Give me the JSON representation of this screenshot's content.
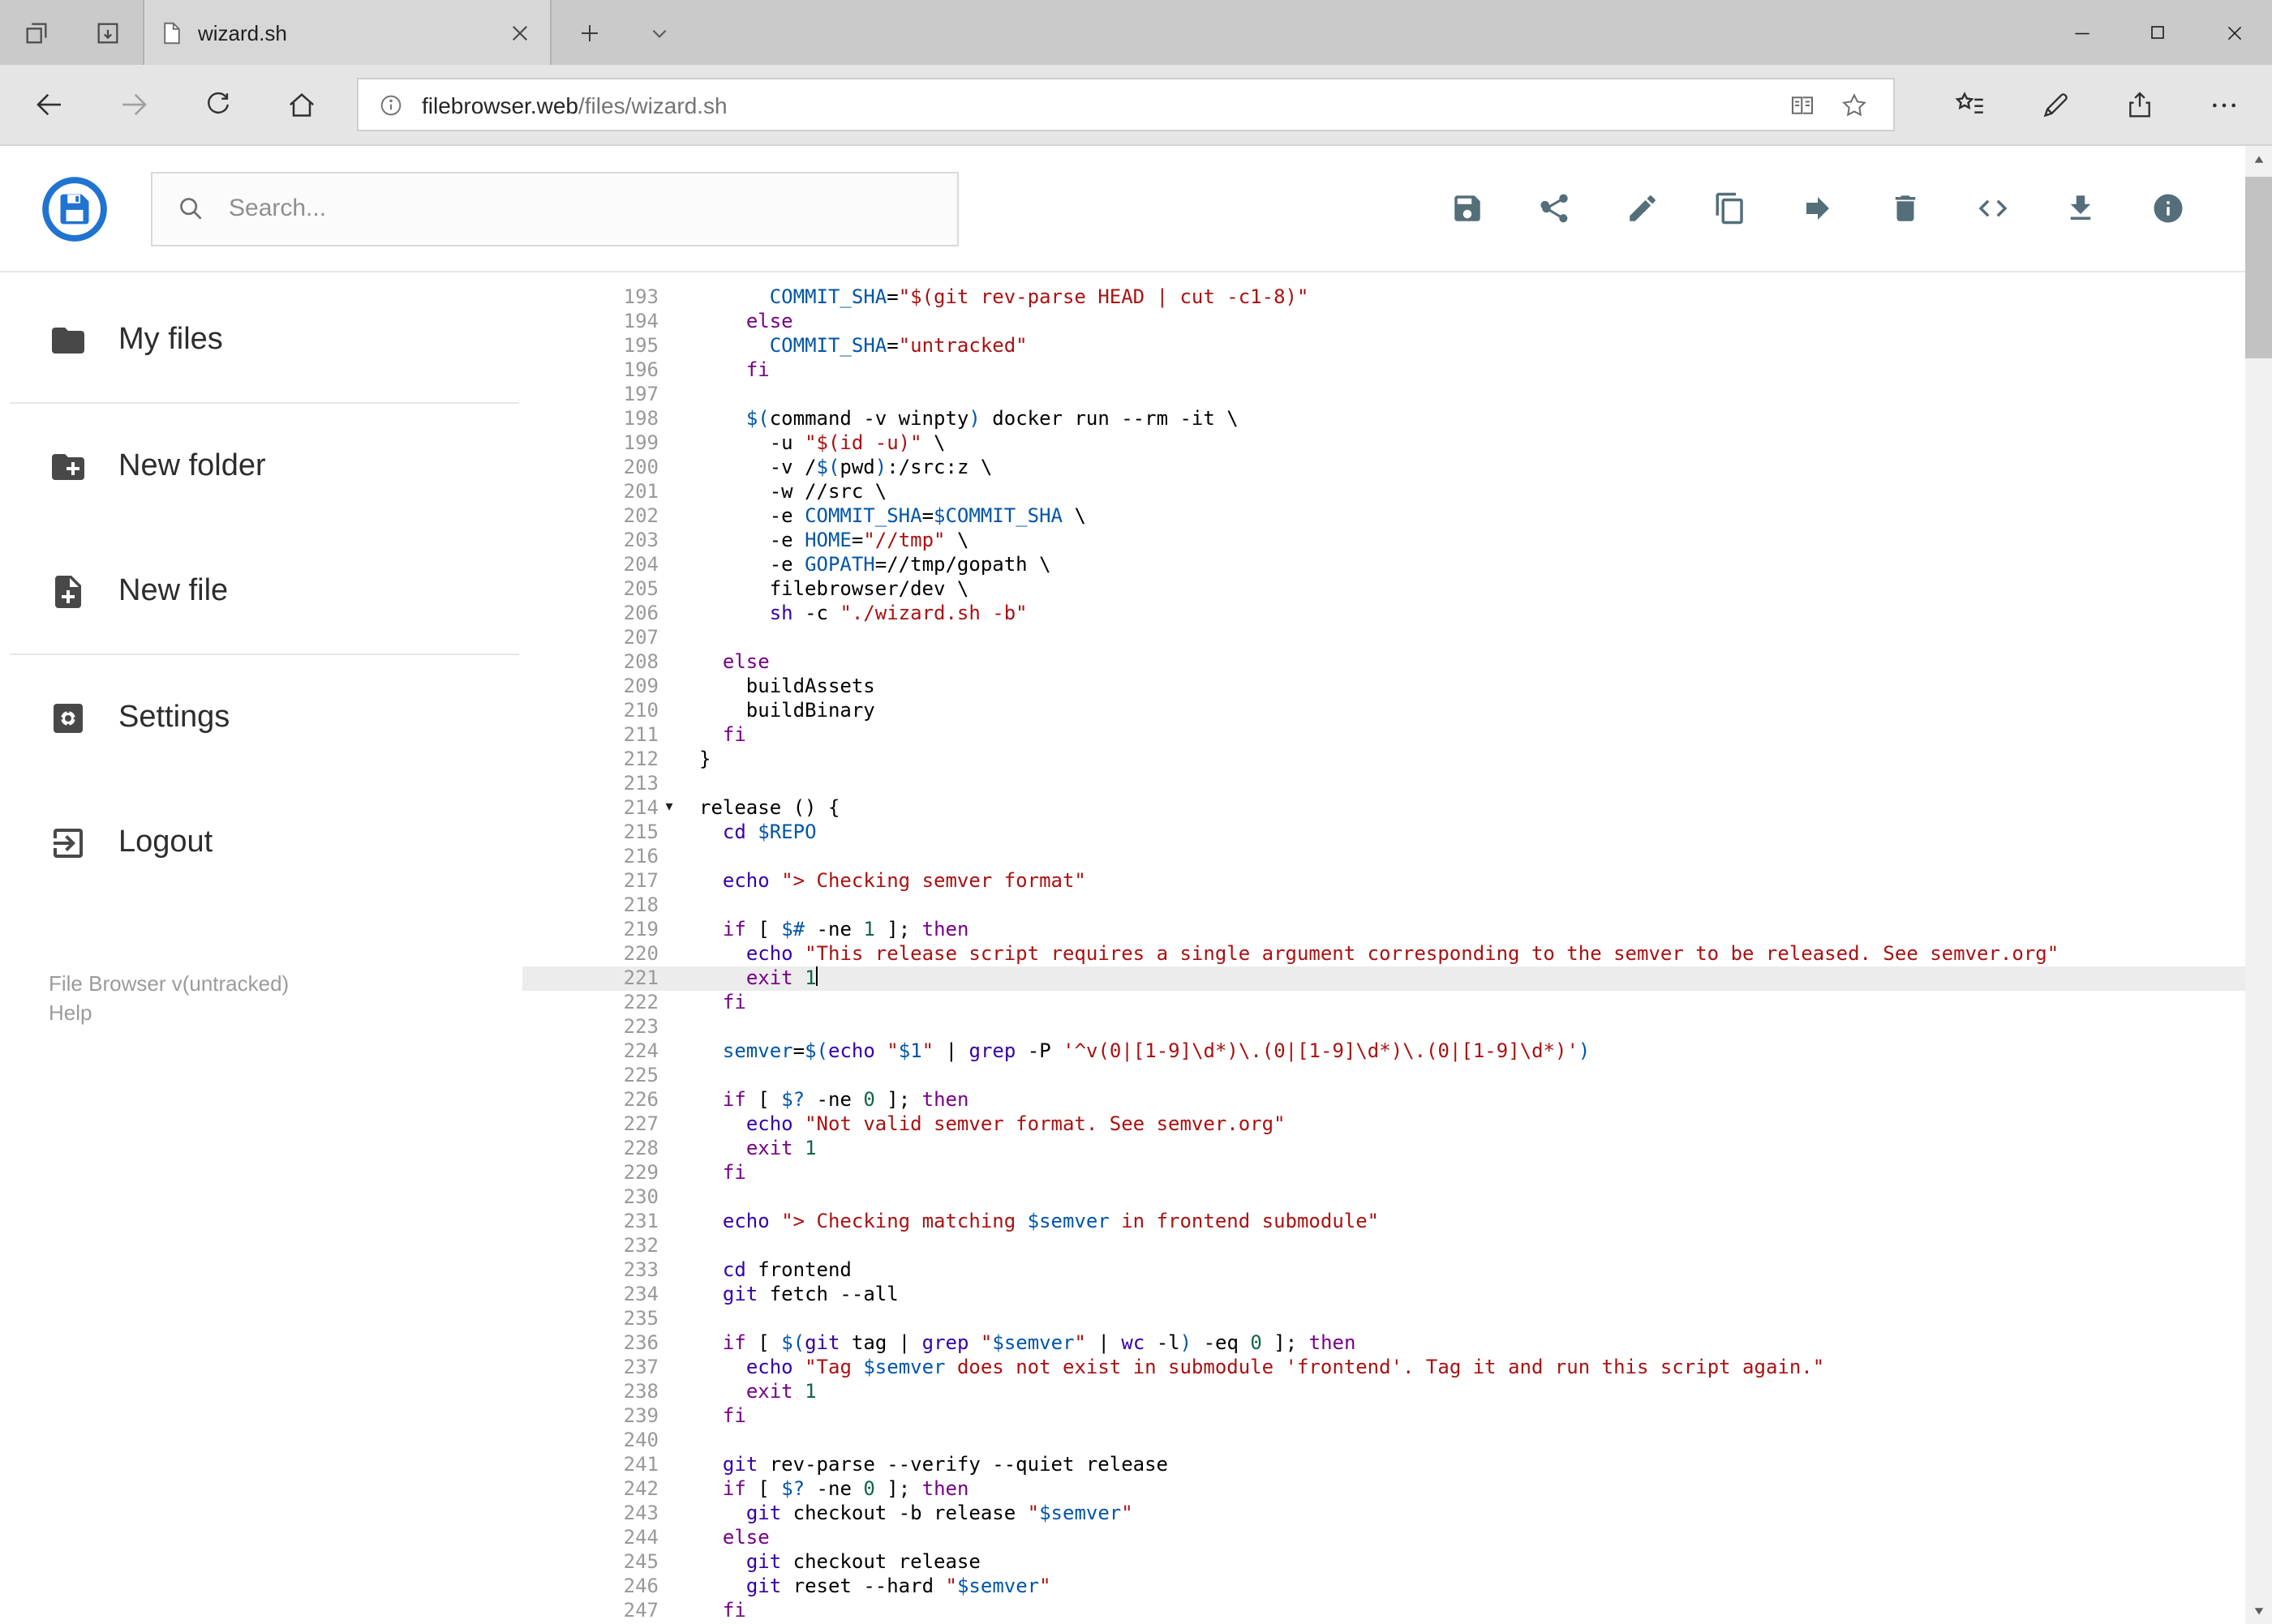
{
  "browser": {
    "tab_title": "wizard.sh",
    "url_host": "filebrowser.web",
    "url_path": "/files/wizard.sh"
  },
  "header": {
    "search_placeholder": "Search...",
    "toolbar_icons": [
      "save-icon",
      "share-icon",
      "edit-icon",
      "copy-icon",
      "move-icon",
      "delete-icon",
      "code-icon",
      "download-icon",
      "info-icon"
    ]
  },
  "sidebar": {
    "items": [
      {
        "label": "My files",
        "icon": "folder-icon"
      },
      {
        "label": "New folder",
        "icon": "new-folder-icon"
      },
      {
        "label": "New file",
        "icon": "new-file-icon"
      },
      {
        "label": "Settings",
        "icon": "settings-icon"
      },
      {
        "label": "Logout",
        "icon": "logout-icon"
      }
    ],
    "footer_version": "File Browser v(untracked)",
    "footer_help": "Help"
  },
  "colors": {
    "keyword": "#770088",
    "builtin": "#3300aa",
    "variable": "#0055aa",
    "string": "#aa1111",
    "number": "#116644",
    "lineNumber": "#999999",
    "activeLine": "#ececec",
    "accentBlue": "#2173d2"
  },
  "editor": {
    "active_line": 221,
    "lines": [
      {
        "n": 193,
        "seg": [
          [
            "p",
            "      "
          ],
          [
            "v",
            "COMMIT_SHA"
          ],
          [
            "p",
            "="
          ],
          [
            "s",
            "\"$(git rev-parse HEAD | cut -c1-8)\""
          ]
        ]
      },
      {
        "n": 194,
        "seg": [
          [
            "p",
            "    "
          ],
          [
            "k",
            "else"
          ]
        ]
      },
      {
        "n": 195,
        "seg": [
          [
            "p",
            "      "
          ],
          [
            "v",
            "COMMIT_SHA"
          ],
          [
            "p",
            "="
          ],
          [
            "s",
            "\"untracked\""
          ]
        ]
      },
      {
        "n": 196,
        "seg": [
          [
            "p",
            "    "
          ],
          [
            "k",
            "fi"
          ]
        ]
      },
      {
        "n": 197,
        "seg": []
      },
      {
        "n": 198,
        "seg": [
          [
            "p",
            "    "
          ],
          [
            "v",
            "$("
          ],
          [
            "p",
            "command -v winpty"
          ],
          [
            "v",
            ")"
          ],
          [
            "p",
            " docker run --rm -it \\"
          ]
        ]
      },
      {
        "n": 199,
        "seg": [
          [
            "p",
            "      -u "
          ],
          [
            "s",
            "\"$(id -u)\""
          ],
          [
            "p",
            " \\"
          ]
        ]
      },
      {
        "n": 200,
        "seg": [
          [
            "p",
            "      -v /"
          ],
          [
            "v",
            "$("
          ],
          [
            "p",
            "pwd"
          ],
          [
            "v",
            ")"
          ],
          [
            "p",
            ":/src:z \\"
          ]
        ]
      },
      {
        "n": 201,
        "seg": [
          [
            "p",
            "      -w //src \\"
          ]
        ]
      },
      {
        "n": 202,
        "seg": [
          [
            "p",
            "      -e "
          ],
          [
            "v",
            "COMMIT_SHA"
          ],
          [
            "p",
            "="
          ],
          [
            "v",
            "$COMMIT_SHA"
          ],
          [
            "p",
            " \\"
          ]
        ]
      },
      {
        "n": 203,
        "seg": [
          [
            "p",
            "      -e "
          ],
          [
            "v",
            "HOME"
          ],
          [
            "p",
            "="
          ],
          [
            "s",
            "\"//tmp\""
          ],
          [
            "p",
            " \\"
          ]
        ]
      },
      {
        "n": 204,
        "seg": [
          [
            "p",
            "      -e "
          ],
          [
            "v",
            "GOPATH"
          ],
          [
            "p",
            "=//tmp/gopath \\"
          ]
        ]
      },
      {
        "n": 205,
        "seg": [
          [
            "p",
            "      filebrowser/dev \\"
          ]
        ]
      },
      {
        "n": 206,
        "seg": [
          [
            "p",
            "      "
          ],
          [
            "b",
            "sh"
          ],
          [
            "p",
            " -c "
          ],
          [
            "s",
            "\"./wizard.sh -b\""
          ]
        ]
      },
      {
        "n": 207,
        "seg": []
      },
      {
        "n": 208,
        "seg": [
          [
            "p",
            "  "
          ],
          [
            "k",
            "else"
          ]
        ]
      },
      {
        "n": 209,
        "seg": [
          [
            "p",
            "    buildAssets"
          ]
        ]
      },
      {
        "n": 210,
        "seg": [
          [
            "p",
            "    buildBinary"
          ]
        ]
      },
      {
        "n": 211,
        "seg": [
          [
            "p",
            "  "
          ],
          [
            "k",
            "fi"
          ]
        ]
      },
      {
        "n": 212,
        "seg": [
          [
            "p",
            "}"
          ]
        ]
      },
      {
        "n": 213,
        "seg": []
      },
      {
        "n": 214,
        "fold": true,
        "seg": [
          [
            "p",
            "release () {"
          ]
        ]
      },
      {
        "n": 215,
        "seg": [
          [
            "p",
            "  "
          ],
          [
            "b",
            "cd"
          ],
          [
            "p",
            " "
          ],
          [
            "v",
            "$REPO"
          ]
        ]
      },
      {
        "n": 216,
        "seg": []
      },
      {
        "n": 217,
        "seg": [
          [
            "p",
            "  "
          ],
          [
            "b",
            "echo"
          ],
          [
            "p",
            " "
          ],
          [
            "s",
            "\"> Checking semver format\""
          ]
        ]
      },
      {
        "n": 218,
        "seg": []
      },
      {
        "n": 219,
        "seg": [
          [
            "p",
            "  "
          ],
          [
            "k",
            "if"
          ],
          [
            "p",
            " [ "
          ],
          [
            "v",
            "$#"
          ],
          [
            "p",
            " -ne "
          ],
          [
            "n",
            "1"
          ],
          [
            "p",
            " ]; "
          ],
          [
            "k",
            "then"
          ]
        ]
      },
      {
        "n": 220,
        "seg": [
          [
            "p",
            "    "
          ],
          [
            "b",
            "echo"
          ],
          [
            "p",
            " "
          ],
          [
            "s",
            "\"This release script requires a single argument corresponding to the semver to be released. See semver.org\""
          ]
        ]
      },
      {
        "n": 221,
        "active": true,
        "cursor": true,
        "seg": [
          [
            "p",
            "    "
          ],
          [
            "k",
            "exit"
          ],
          [
            "p",
            " "
          ],
          [
            "n",
            "1"
          ]
        ]
      },
      {
        "n": 222,
        "seg": [
          [
            "p",
            "  "
          ],
          [
            "k",
            "fi"
          ]
        ]
      },
      {
        "n": 223,
        "seg": []
      },
      {
        "n": 224,
        "seg": [
          [
            "p",
            "  "
          ],
          [
            "v",
            "semver"
          ],
          [
            "p",
            "="
          ],
          [
            "v",
            "$("
          ],
          [
            "b",
            "echo"
          ],
          [
            "p",
            " "
          ],
          [
            "s",
            "\""
          ],
          [
            "v",
            "$1"
          ],
          [
            "s",
            "\""
          ],
          [
            "p",
            " | "
          ],
          [
            "b",
            "grep"
          ],
          [
            "p",
            " -P "
          ],
          [
            "s",
            "'^v(0|[1-9]\\d*)\\.(0|[1-9]\\d*)\\.(0|[1-9]\\d*)'"
          ],
          [
            "v",
            ")"
          ]
        ]
      },
      {
        "n": 225,
        "seg": []
      },
      {
        "n": 226,
        "seg": [
          [
            "p",
            "  "
          ],
          [
            "k",
            "if"
          ],
          [
            "p",
            " [ "
          ],
          [
            "v",
            "$?"
          ],
          [
            "p",
            " -ne "
          ],
          [
            "n",
            "0"
          ],
          [
            "p",
            " ]; "
          ],
          [
            "k",
            "then"
          ]
        ]
      },
      {
        "n": 227,
        "seg": [
          [
            "p",
            "    "
          ],
          [
            "b",
            "echo"
          ],
          [
            "p",
            " "
          ],
          [
            "s",
            "\"Not valid semver format. See semver.org\""
          ]
        ]
      },
      {
        "n": 228,
        "seg": [
          [
            "p",
            "    "
          ],
          [
            "k",
            "exit"
          ],
          [
            "p",
            " "
          ],
          [
            "n",
            "1"
          ]
        ]
      },
      {
        "n": 229,
        "seg": [
          [
            "p",
            "  "
          ],
          [
            "k",
            "fi"
          ]
        ]
      },
      {
        "n": 230,
        "seg": []
      },
      {
        "n": 231,
        "seg": [
          [
            "p",
            "  "
          ],
          [
            "b",
            "echo"
          ],
          [
            "p",
            " "
          ],
          [
            "s",
            "\"> Checking matching "
          ],
          [
            "v",
            "$semver"
          ],
          [
            "s",
            " in frontend submodule\""
          ]
        ]
      },
      {
        "n": 232,
        "seg": []
      },
      {
        "n": 233,
        "seg": [
          [
            "p",
            "  "
          ],
          [
            "b",
            "cd"
          ],
          [
            "p",
            " frontend"
          ]
        ]
      },
      {
        "n": 234,
        "seg": [
          [
            "p",
            "  "
          ],
          [
            "b",
            "git"
          ],
          [
            "p",
            " fetch --all"
          ]
        ]
      },
      {
        "n": 235,
        "seg": []
      },
      {
        "n": 236,
        "seg": [
          [
            "p",
            "  "
          ],
          [
            "k",
            "if"
          ],
          [
            "p",
            " [ "
          ],
          [
            "v",
            "$("
          ],
          [
            "b",
            "git"
          ],
          [
            "p",
            " tag | "
          ],
          [
            "b",
            "grep"
          ],
          [
            "p",
            " "
          ],
          [
            "s",
            "\""
          ],
          [
            "v",
            "$semver"
          ],
          [
            "s",
            "\""
          ],
          [
            "p",
            " | "
          ],
          [
            "b",
            "wc"
          ],
          [
            "p",
            " -l"
          ],
          [
            "v",
            ")"
          ],
          [
            "p",
            " -eq "
          ],
          [
            "n",
            "0"
          ],
          [
            "p",
            " ]; "
          ],
          [
            "k",
            "then"
          ]
        ]
      },
      {
        "n": 237,
        "seg": [
          [
            "p",
            "    "
          ],
          [
            "b",
            "echo"
          ],
          [
            "p",
            " "
          ],
          [
            "s",
            "\"Tag "
          ],
          [
            "v",
            "$semver"
          ],
          [
            "s",
            " does not exist in submodule 'frontend'. Tag it and run this script again.\""
          ]
        ]
      },
      {
        "n": 238,
        "seg": [
          [
            "p",
            "    "
          ],
          [
            "k",
            "exit"
          ],
          [
            "p",
            " "
          ],
          [
            "n",
            "1"
          ]
        ]
      },
      {
        "n": 239,
        "seg": [
          [
            "p",
            "  "
          ],
          [
            "k",
            "fi"
          ]
        ]
      },
      {
        "n": 240,
        "seg": []
      },
      {
        "n": 241,
        "seg": [
          [
            "p",
            "  "
          ],
          [
            "b",
            "git"
          ],
          [
            "p",
            " rev-parse --verify --quiet release"
          ]
        ]
      },
      {
        "n": 242,
        "seg": [
          [
            "p",
            "  "
          ],
          [
            "k",
            "if"
          ],
          [
            "p",
            " [ "
          ],
          [
            "v",
            "$?"
          ],
          [
            "p",
            " -ne "
          ],
          [
            "n",
            "0"
          ],
          [
            "p",
            " ]; "
          ],
          [
            "k",
            "then"
          ]
        ]
      },
      {
        "n": 243,
        "seg": [
          [
            "p",
            "    "
          ],
          [
            "b",
            "git"
          ],
          [
            "p",
            " checkout -b release "
          ],
          [
            "s",
            "\""
          ],
          [
            "v",
            "$semver"
          ],
          [
            "s",
            "\""
          ]
        ]
      },
      {
        "n": 244,
        "seg": [
          [
            "p",
            "  "
          ],
          [
            "k",
            "else"
          ]
        ]
      },
      {
        "n": 245,
        "seg": [
          [
            "p",
            "    "
          ],
          [
            "b",
            "git"
          ],
          [
            "p",
            " checkout release"
          ]
        ]
      },
      {
        "n": 246,
        "seg": [
          [
            "p",
            "    "
          ],
          [
            "b",
            "git"
          ],
          [
            "p",
            " reset --hard "
          ],
          [
            "s",
            "\""
          ],
          [
            "v",
            "$semver"
          ],
          [
            "s",
            "\""
          ]
        ]
      },
      {
        "n": 247,
        "seg": [
          [
            "p",
            "  "
          ],
          [
            "k",
            "fi"
          ]
        ]
      }
    ]
  }
}
